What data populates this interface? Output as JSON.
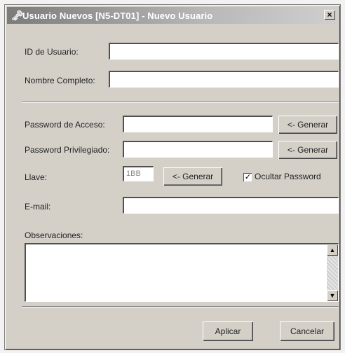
{
  "window": {
    "title": "Usuario Nuevos [N5-DT01] - Nuevo Usuario",
    "close_symbol": "×"
  },
  "form": {
    "user_id_label": "ID de Usuario:",
    "full_name_label": "Nombre Completo:",
    "access_password_label": "Password de Acceso:",
    "privileged_password_label": "Password Privilegiado:",
    "key_label": "Llave:",
    "key_value": "1BB",
    "email_label": "E-mail:",
    "observations_label": "Observaciones:",
    "hide_password_label": "Ocultar Password",
    "hide_password_checked": true
  },
  "buttons": {
    "generate_access": "<- Generar",
    "generate_privileged": "<- Generar",
    "generate_key": "<- Generar",
    "apply": "Aplicar",
    "cancel": "Cancelar"
  },
  "icons": {
    "title_icon": "key-icon",
    "checkbox_mark": "✓",
    "scroll_up": "▲",
    "scroll_down": "▼"
  }
}
